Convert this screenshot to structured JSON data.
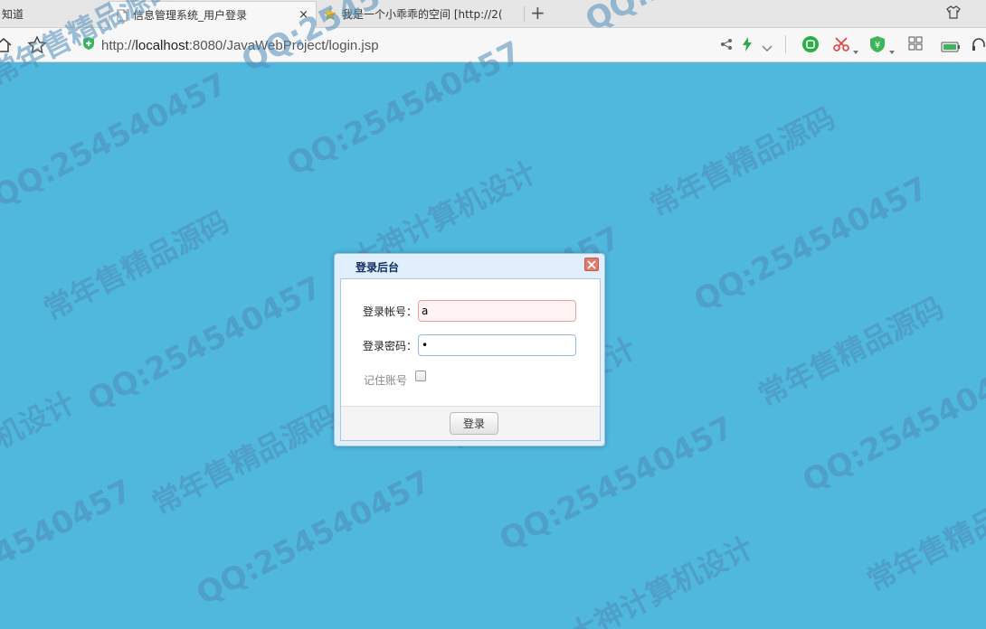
{
  "browser": {
    "tabs": [
      {
        "title": "知道",
        "icon": "page-icon"
      },
      {
        "title": "信息管理系统_用户登录",
        "icon": "document-icon",
        "active": true
      },
      {
        "title": "我是一个小乖乖的空间 [http://2(",
        "icon": "star-icon"
      }
    ],
    "tab_close": "×",
    "new_tab": "+",
    "url": "http://localhost:8080/JavaWebProject/login.jsp",
    "url_host": "localhost",
    "url_prefix": "http://",
    "url_suffix": ":8080/JavaWebProject/login.jsp"
  },
  "watermark": {
    "qq": "QQ:254540457",
    "shop": "常年售精品源码",
    "design": "大神计算机设计"
  },
  "dialog": {
    "title": "登录后台",
    "account_label": "登录帐号：",
    "account_value": "a",
    "password_label": "登录密码：",
    "password_value": "•",
    "remember_label": "记住账号",
    "remember_checked": false,
    "login_button": "登录"
  },
  "colors": {
    "page_bg": "#4fb8dc",
    "dialog_header": "#e1eefc",
    "error_field_bg": "#fff3f3"
  }
}
